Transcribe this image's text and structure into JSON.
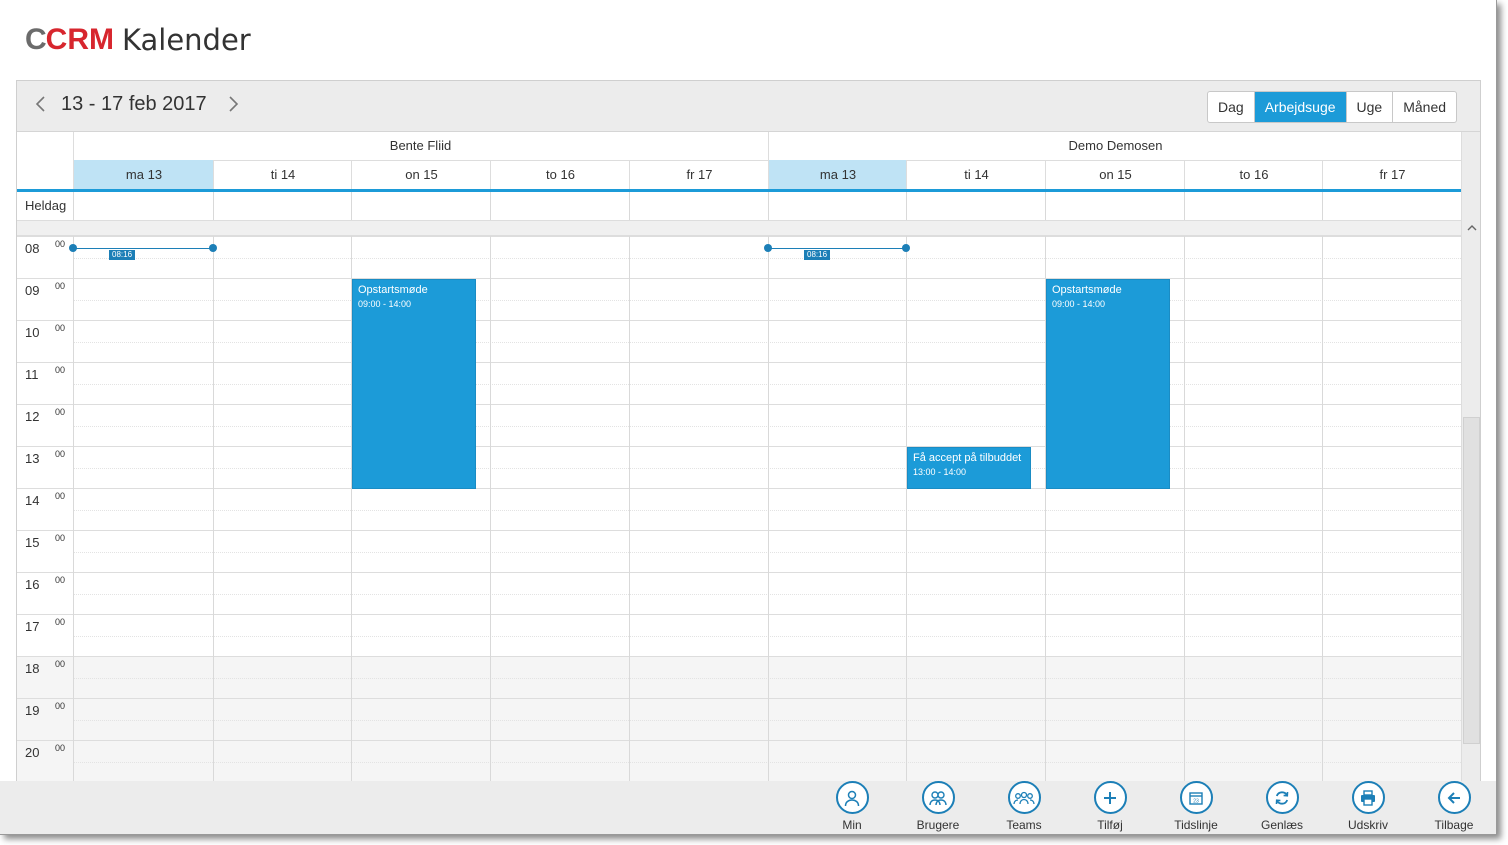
{
  "logo": {
    "c": "C",
    "crm": "CRM",
    "title": "Kalender"
  },
  "toolbar": {
    "prev_icon": "chevron-left-icon",
    "next_icon": "chevron-right-icon",
    "date_range": "13 - 17 feb 2017",
    "views": [
      "Dag",
      "Arbejdsuge",
      "Uge",
      "Måned"
    ],
    "active_view": "Arbejdsuge"
  },
  "resources": [
    {
      "name": "Bente Fliid"
    },
    {
      "name": "Demo Demosen"
    }
  ],
  "days": [
    "ma 13",
    "ti 14",
    "on 15",
    "to 16",
    "fr 17"
  ],
  "today": "ma 13",
  "allday_label": "Heldag",
  "hours": [
    {
      "h": "08",
      "m": "00"
    },
    {
      "h": "09",
      "m": "00"
    },
    {
      "h": "10",
      "m": "00"
    },
    {
      "h": "11",
      "m": "00"
    },
    {
      "h": "12",
      "m": "00"
    },
    {
      "h": "13",
      "m": "00"
    },
    {
      "h": "14",
      "m": "00"
    },
    {
      "h": "15",
      "m": "00"
    },
    {
      "h": "16",
      "m": "00"
    },
    {
      "h": "17",
      "m": "00"
    },
    {
      "h": "18",
      "m": "00"
    },
    {
      "h": "19",
      "m": "00"
    },
    {
      "h": "20",
      "m": "00"
    }
  ],
  "now_time": "08:16",
  "events": [
    {
      "title": "Opstartsmøde",
      "time": "09:00 - 14:00"
    },
    {
      "title": "Få accept på tilbuddet",
      "time": "13:00 - 14:00"
    },
    {
      "title": "Opstartsmøde",
      "time": "09:00 - 14:00"
    }
  ],
  "bottom_buttons": [
    {
      "label": "Min",
      "icon": "user-icon"
    },
    {
      "label": "Brugere",
      "icon": "users-icon"
    },
    {
      "label": "Teams",
      "icon": "teams-icon"
    },
    {
      "label": "Tilføj",
      "icon": "plus-icon"
    },
    {
      "label": "Tidslinje",
      "icon": "calendar-icon"
    },
    {
      "label": "Genlæs",
      "icon": "refresh-icon"
    },
    {
      "label": "Udskriv",
      "icon": "print-icon"
    },
    {
      "label": "Tilbage",
      "icon": "arrow-left-icon"
    }
  ],
  "colors": {
    "accent": "#1c9bd8",
    "today_bg": "#bfe3f5",
    "logo_red": "#d7262e",
    "logo_gray": "#6b6b6b"
  }
}
